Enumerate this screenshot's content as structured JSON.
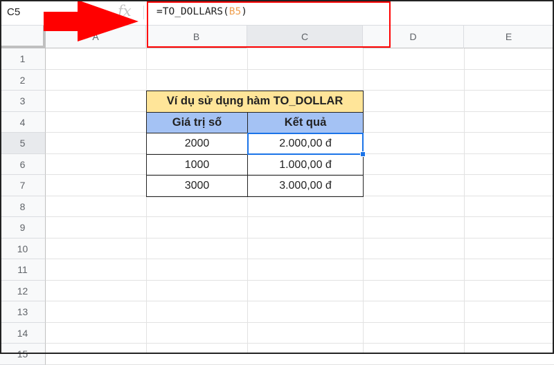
{
  "formula_bar": {
    "name_box": "C5",
    "fx_label": "fx",
    "formula_prefix": "=TO_DOLLARS(",
    "formula_ref": "B5",
    "formula_suffix": ")"
  },
  "columns": [
    "A",
    "B",
    "C",
    "D",
    "E"
  ],
  "selected_column": "C",
  "rows": [
    "1",
    "2",
    "3",
    "4",
    "5",
    "6",
    "7",
    "8",
    "9",
    "10",
    "11",
    "12",
    "13",
    "14",
    "15"
  ],
  "selected_row": "5",
  "table": {
    "title": "Ví dụ sử dụng hàm TO_DOLLAR",
    "headers": [
      "Giá trị số",
      "Kết quả"
    ],
    "rows": [
      [
        "2000",
        "2.000,00 đ"
      ],
      [
        "1000",
        "1.000,00 đ"
      ],
      [
        "3000",
        "3.000,00 đ"
      ]
    ]
  },
  "colors": {
    "title_bg": "#ffe599",
    "header_bg": "#a4c2f4",
    "selection": "#1a73e8",
    "annotation": "#ff0000"
  }
}
